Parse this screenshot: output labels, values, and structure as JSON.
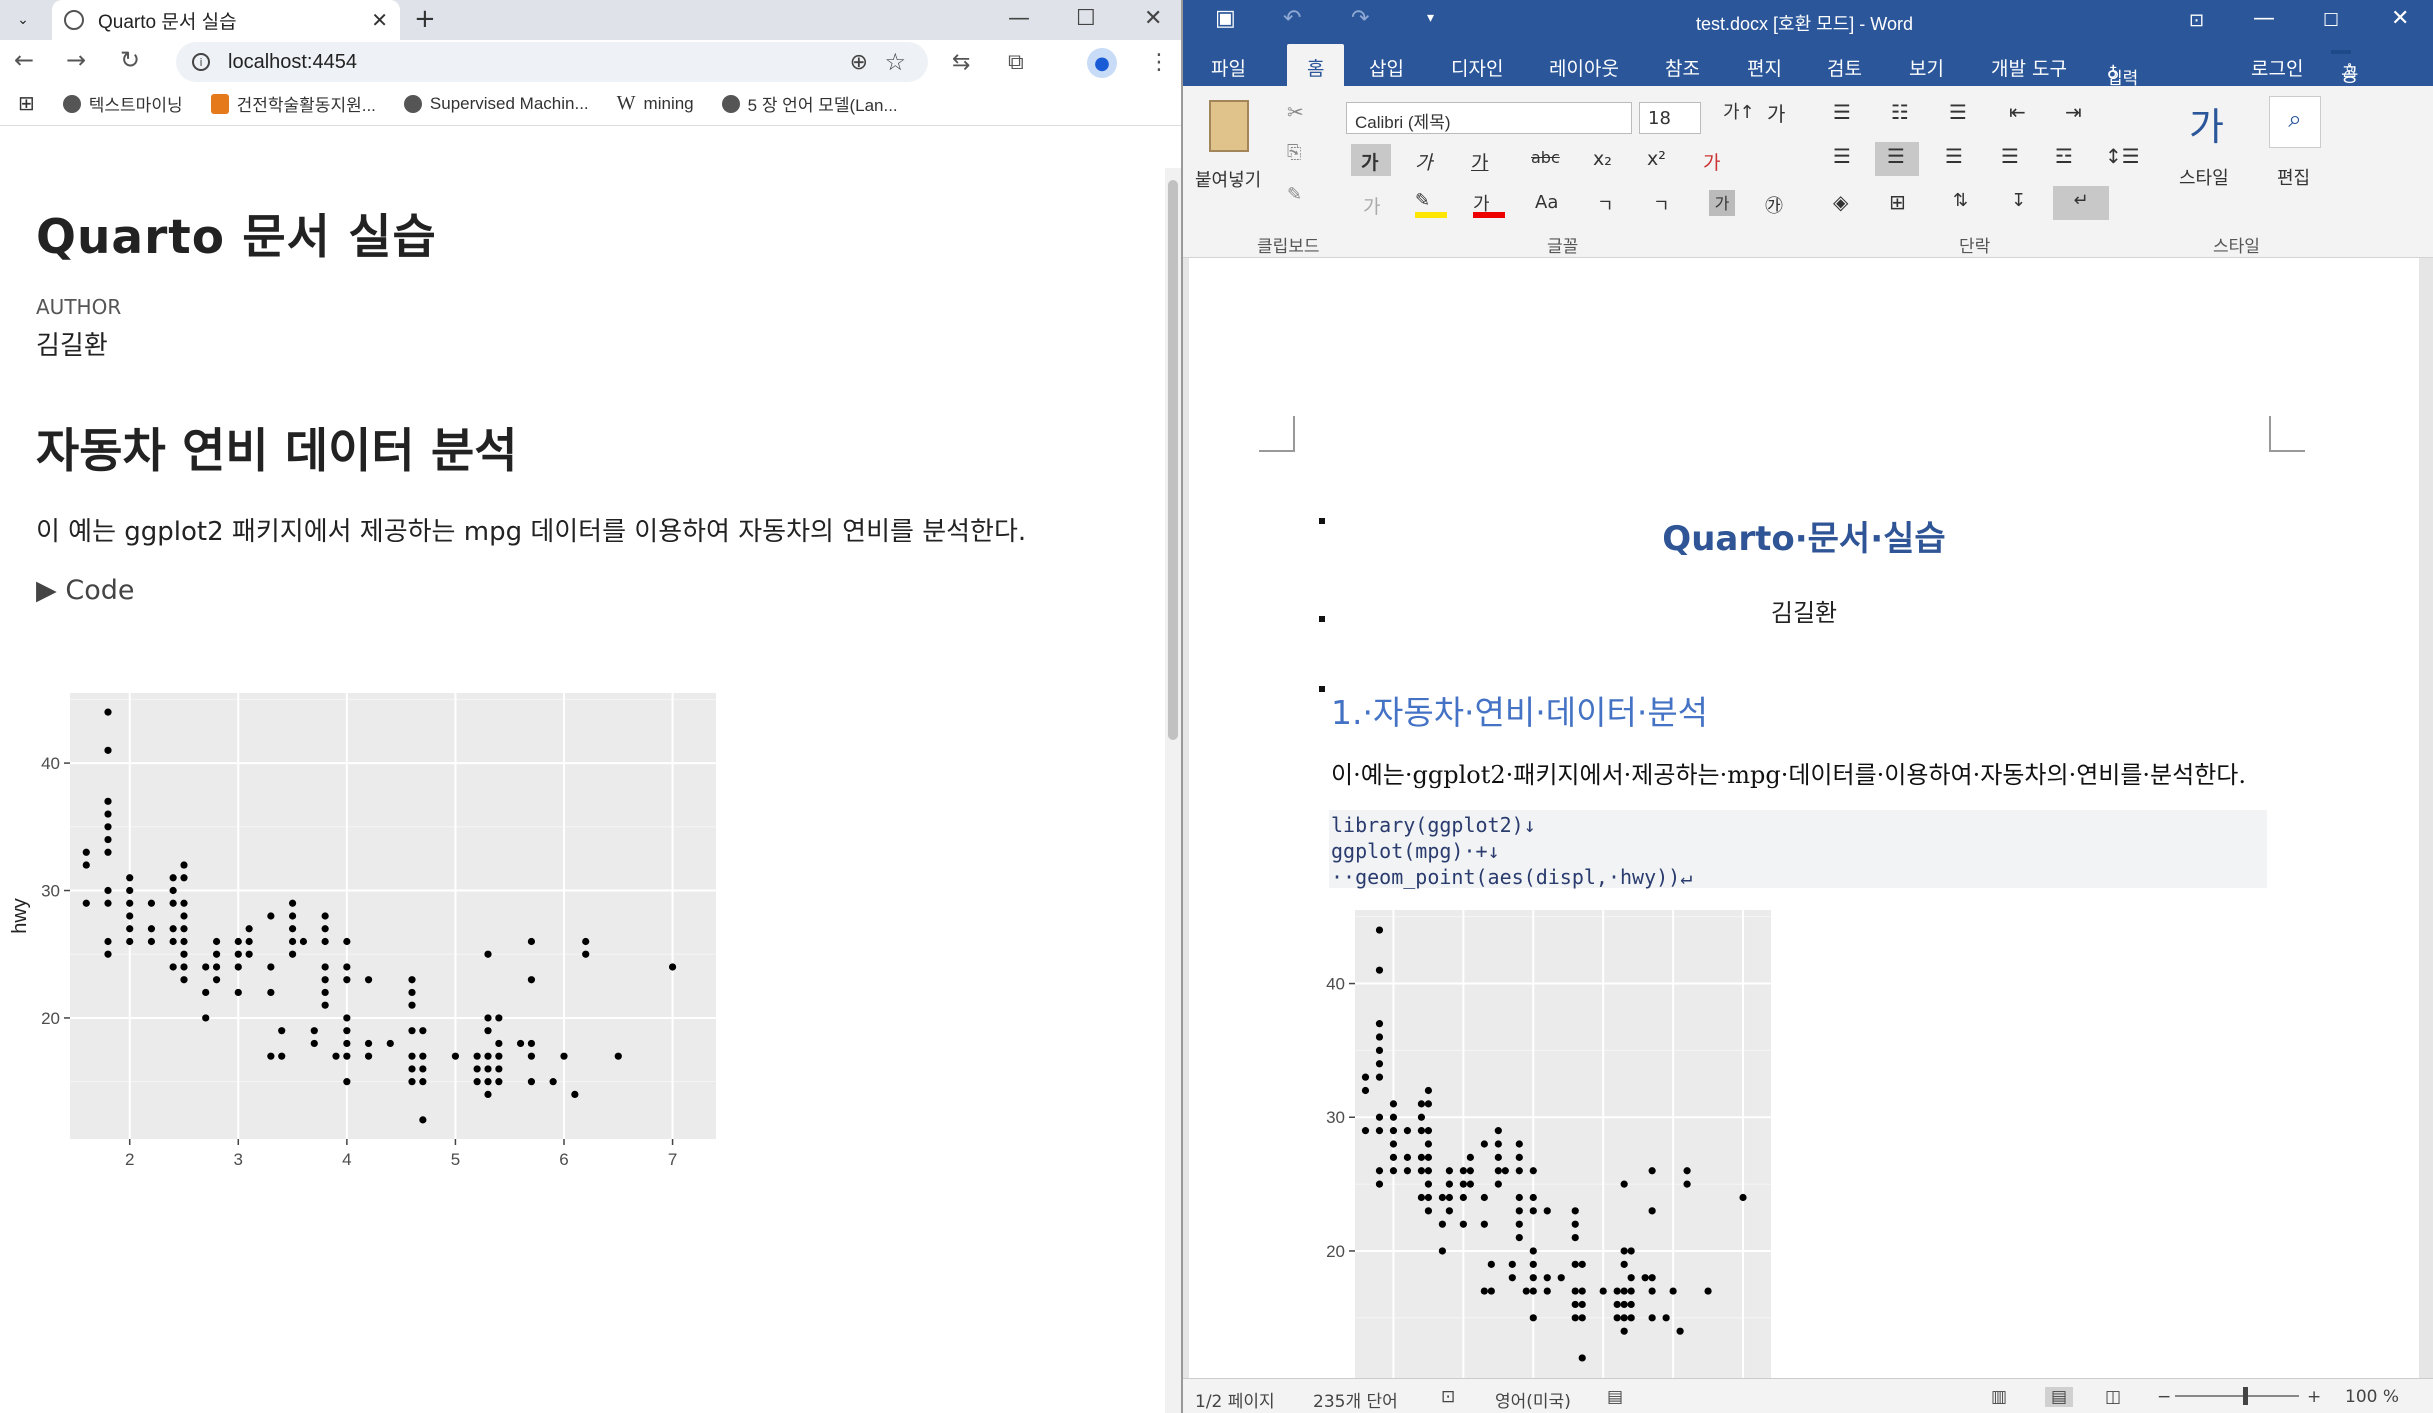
{
  "browser": {
    "tab_title": "Quarto 문서 실습",
    "url": "localhost:4454",
    "bookmarks": [
      "텍스트마이닝",
      "건전학술활동지원...",
      "Supervised Machin...",
      "mining",
      "5 장 언어 모델(Lan..."
    ]
  },
  "quarto": {
    "title": "Quarto 문서 실습",
    "author_label": "AUTHOR",
    "author": "김길환",
    "section": "자동차 연비 데이터 분석",
    "paragraph": "이 예는 ggplot2 패키지에서 제공하는 mpg 데이터를 이용하여 자동차의 연비를 분석한다.",
    "code_toggle": "▶ Code"
  },
  "word": {
    "window_title": "test.docx [호환 모드] - Word",
    "tabs": [
      "파일",
      "홈",
      "삽입",
      "디자인",
      "레이아웃",
      "참조",
      "편지",
      "검토",
      "보기",
      "개발 도구"
    ],
    "tell_me": "입력하세요...",
    "login": "로그인",
    "share": "공유",
    "paste": "붙여넣기",
    "font_name": "Calibri (제목)",
    "font_size": "18",
    "group_clipboard": "클립보드",
    "group_font": "글꼴",
    "group_paragraph": "단락",
    "group_style": "스타일",
    "style_label": "스타일",
    "edit_label": "편집",
    "doc_title": "Quarto·문서·실습",
    "doc_author": "김길환",
    "doc_heading": "1.·자동차·연비·데이터·분석",
    "doc_paragraph": "이·예는·ggplot2·패키지에서·제공하는·mpg·데이터를·이용하여·자동차의·연비를·분석한다.",
    "code_lines": [
      "library(ggplot2)↓",
      "ggplot(mpg)·+↓",
      "··geom_point(aes(displ,·hwy))↵"
    ],
    "status_page": "1/2 페이지",
    "status_words": "235개 단어",
    "status_lang": "영어(미국)",
    "zoom": "100 %"
  },
  "chart_data": {
    "type": "scatter",
    "xlabel": "displ",
    "ylabel": "hwy",
    "x_ticks": [
      2,
      3,
      4,
      5,
      6,
      7
    ],
    "y_ticks": [
      20,
      30,
      40
    ],
    "xlim": [
      1.45,
      7.4
    ],
    "ylim": [
      10.5,
      45.5
    ],
    "points": [
      [
        1.6,
        33
      ],
      [
        1.6,
        32
      ],
      [
        1.6,
        29
      ],
      [
        1.8,
        44
      ],
      [
        1.8,
        41
      ],
      [
        1.8,
        37
      ],
      [
        1.8,
        36
      ],
      [
        1.8,
        35
      ],
      [
        1.8,
        34
      ],
      [
        1.8,
        33
      ],
      [
        1.8,
        30
      ],
      [
        1.8,
        29
      ],
      [
        1.8,
        26
      ],
      [
        1.8,
        25
      ],
      [
        2,
        31
      ],
      [
        2,
        30
      ],
      [
        2,
        29
      ],
      [
        2,
        28
      ],
      [
        2,
        27
      ],
      [
        2,
        26
      ],
      [
        2.2,
        29
      ],
      [
        2.2,
        27
      ],
      [
        2.2,
        26
      ],
      [
        2.4,
        31
      ],
      [
        2.4,
        30
      ],
      [
        2.4,
        29
      ],
      [
        2.4,
        27
      ],
      [
        2.4,
        26
      ],
      [
        2.4,
        24
      ],
      [
        2.5,
        32
      ],
      [
        2.5,
        31
      ],
      [
        2.5,
        29
      ],
      [
        2.5,
        28
      ],
      [
        2.5,
        27
      ],
      [
        2.5,
        26
      ],
      [
        2.5,
        25
      ],
      [
        2.5,
        24
      ],
      [
        2.5,
        23
      ],
      [
        2.7,
        24
      ],
      [
        2.7,
        22
      ],
      [
        2.7,
        20
      ],
      [
        2.8,
        26
      ],
      [
        2.8,
        25
      ],
      [
        2.8,
        24
      ],
      [
        2.8,
        23
      ],
      [
        3,
        26
      ],
      [
        3,
        25
      ],
      [
        3,
        24
      ],
      [
        3,
        22
      ],
      [
        3.1,
        27
      ],
      [
        3.1,
        26
      ],
      [
        3.1,
        25
      ],
      [
        3.3,
        28
      ],
      [
        3.3,
        24
      ],
      [
        3.3,
        22
      ],
      [
        3.3,
        17
      ],
      [
        3.4,
        19
      ],
      [
        3.4,
        17
      ],
      [
        3.5,
        29
      ],
      [
        3.5,
        28
      ],
      [
        3.5,
        27
      ],
      [
        3.5,
        26
      ],
      [
        3.5,
        25
      ],
      [
        3.6,
        26
      ],
      [
        3.7,
        19
      ],
      [
        3.7,
        18
      ],
      [
        3.8,
        28
      ],
      [
        3.8,
        27
      ],
      [
        3.8,
        26
      ],
      [
        3.8,
        24
      ],
      [
        3.8,
        23
      ],
      [
        3.8,
        22
      ],
      [
        3.8,
        21
      ],
      [
        3.9,
        17
      ],
      [
        4,
        26
      ],
      [
        4,
        24
      ],
      [
        4,
        23
      ],
      [
        4,
        20
      ],
      [
        4,
        19
      ],
      [
        4,
        18
      ],
      [
        4,
        17
      ],
      [
        4,
        15
      ],
      [
        4.2,
        23
      ],
      [
        4.2,
        18
      ],
      [
        4.2,
        17
      ],
      [
        4.4,
        18
      ],
      [
        4.6,
        23
      ],
      [
        4.6,
        22
      ],
      [
        4.6,
        21
      ],
      [
        4.6,
        19
      ],
      [
        4.6,
        17
      ],
      [
        4.6,
        16
      ],
      [
        4.6,
        15
      ],
      [
        4.7,
        19
      ],
      [
        4.7,
        17
      ],
      [
        4.7,
        16
      ],
      [
        4.7,
        15
      ],
      [
        4.7,
        12
      ],
      [
        5,
        17
      ],
      [
        5.2,
        17
      ],
      [
        5.2,
        16
      ],
      [
        5.2,
        15
      ],
      [
        5.3,
        25
      ],
      [
        5.3,
        20
      ],
      [
        5.3,
        19
      ],
      [
        5.3,
        17
      ],
      [
        5.3,
        16
      ],
      [
        5.3,
        15
      ],
      [
        5.3,
        14
      ],
      [
        5.4,
        20
      ],
      [
        5.4,
        18
      ],
      [
        5.4,
        17
      ],
      [
        5.4,
        16
      ],
      [
        5.4,
        15
      ],
      [
        5.6,
        18
      ],
      [
        5.7,
        26
      ],
      [
        5.7,
        23
      ],
      [
        5.7,
        18
      ],
      [
        5.7,
        17
      ],
      [
        5.7,
        15
      ],
      [
        5.9,
        15
      ],
      [
        6,
        17
      ],
      [
        6.1,
        14
      ],
      [
        6.2,
        26
      ],
      [
        6.2,
        25
      ],
      [
        6.5,
        17
      ],
      [
        7,
        24
      ]
    ]
  }
}
